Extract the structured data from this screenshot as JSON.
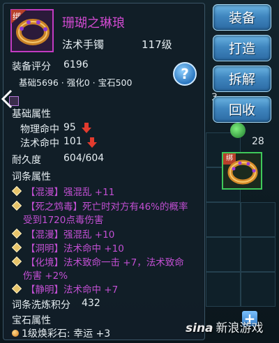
{
  "item": {
    "bind_tag": "绑",
    "name": "珊瑚之琳琅",
    "slot_type": "法术手镯",
    "level": "117级",
    "score_label": "装备评分",
    "score_value": "6196",
    "score_breakdown": "基础5696 · 强化0 · 宝石500",
    "help_glyph": "?",
    "base_attr_title": "基础属性",
    "base_attrs": [
      {
        "label": "物理命中",
        "value": "95"
      },
      {
        "label": "法术命中",
        "value": "101"
      }
    ],
    "durability_label": "耐久度",
    "durability_value": "604/604",
    "affix_title": "词条属性",
    "affixes": [
      "【混漫】强混乱 +11",
      "【死之鸩毒】死亡时对方有46%的概率",
      "受到1720点毒伤害",
      "【混漫】强混乱 +10",
      "【洞明】法术命中 +10",
      "【化境】法术致命一击 +7，法术致命",
      "伤害 +2%",
      "【静明】法术命中 +7"
    ],
    "refine_label": "词条洗炼积分",
    "refine_value": "432",
    "gem_title": "宝石属性",
    "gem_line": "1级焕彩石: 幸运 +3"
  },
  "side_buttons": [
    "装备",
    "打造",
    "拆解",
    "回收"
  ],
  "inventory": {
    "count_3": "3",
    "count_28": "28",
    "bind_tag": "绑"
  },
  "plus_glyph": "+",
  "watermark": {
    "logo": "sina",
    "text": "新浪游戏"
  },
  "colors": {
    "item_name": "#d04ad0",
    "affix": "#c24fd3",
    "arrow_down": "#e23b2e",
    "button": "#3f86bf"
  },
  "icons": [
    "bracelet-icon",
    "help-icon",
    "collapse-icon",
    "down-arrow-icon",
    "diamond-bullet-icon",
    "gem-icon",
    "plus-icon"
  ]
}
